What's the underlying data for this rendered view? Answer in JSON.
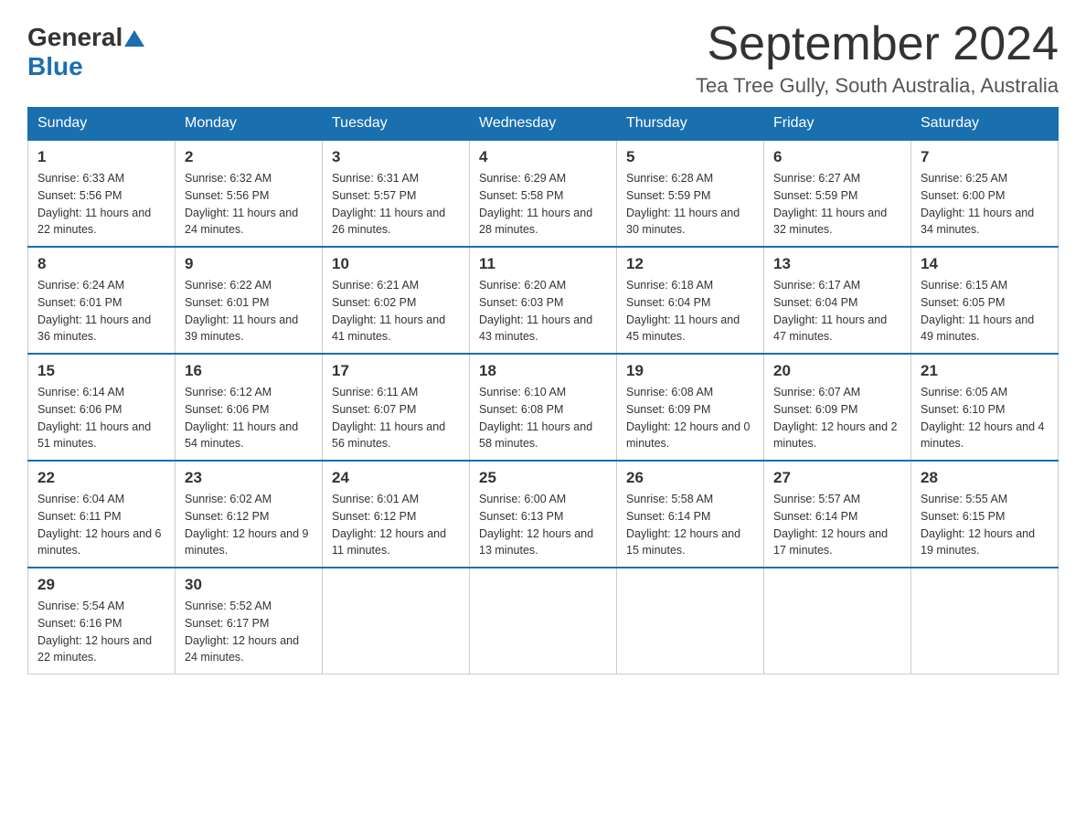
{
  "header": {
    "logo": {
      "general_text": "General",
      "blue_text": "Blue"
    },
    "title": "September 2024",
    "subtitle": "Tea Tree Gully, South Australia, Australia"
  },
  "days_of_week": [
    "Sunday",
    "Monday",
    "Tuesday",
    "Wednesday",
    "Thursday",
    "Friday",
    "Saturday"
  ],
  "weeks": [
    [
      {
        "day": "1",
        "sunrise": "Sunrise: 6:33 AM",
        "sunset": "Sunset: 5:56 PM",
        "daylight": "Daylight: 11 hours and 22 minutes."
      },
      {
        "day": "2",
        "sunrise": "Sunrise: 6:32 AM",
        "sunset": "Sunset: 5:56 PM",
        "daylight": "Daylight: 11 hours and 24 minutes."
      },
      {
        "day": "3",
        "sunrise": "Sunrise: 6:31 AM",
        "sunset": "Sunset: 5:57 PM",
        "daylight": "Daylight: 11 hours and 26 minutes."
      },
      {
        "day": "4",
        "sunrise": "Sunrise: 6:29 AM",
        "sunset": "Sunset: 5:58 PM",
        "daylight": "Daylight: 11 hours and 28 minutes."
      },
      {
        "day": "5",
        "sunrise": "Sunrise: 6:28 AM",
        "sunset": "Sunset: 5:59 PM",
        "daylight": "Daylight: 11 hours and 30 minutes."
      },
      {
        "day": "6",
        "sunrise": "Sunrise: 6:27 AM",
        "sunset": "Sunset: 5:59 PM",
        "daylight": "Daylight: 11 hours and 32 minutes."
      },
      {
        "day": "7",
        "sunrise": "Sunrise: 6:25 AM",
        "sunset": "Sunset: 6:00 PM",
        "daylight": "Daylight: 11 hours and 34 minutes."
      }
    ],
    [
      {
        "day": "8",
        "sunrise": "Sunrise: 6:24 AM",
        "sunset": "Sunset: 6:01 PM",
        "daylight": "Daylight: 11 hours and 36 minutes."
      },
      {
        "day": "9",
        "sunrise": "Sunrise: 6:22 AM",
        "sunset": "Sunset: 6:01 PM",
        "daylight": "Daylight: 11 hours and 39 minutes."
      },
      {
        "day": "10",
        "sunrise": "Sunrise: 6:21 AM",
        "sunset": "Sunset: 6:02 PM",
        "daylight": "Daylight: 11 hours and 41 minutes."
      },
      {
        "day": "11",
        "sunrise": "Sunrise: 6:20 AM",
        "sunset": "Sunset: 6:03 PM",
        "daylight": "Daylight: 11 hours and 43 minutes."
      },
      {
        "day": "12",
        "sunrise": "Sunrise: 6:18 AM",
        "sunset": "Sunset: 6:04 PM",
        "daylight": "Daylight: 11 hours and 45 minutes."
      },
      {
        "day": "13",
        "sunrise": "Sunrise: 6:17 AM",
        "sunset": "Sunset: 6:04 PM",
        "daylight": "Daylight: 11 hours and 47 minutes."
      },
      {
        "day": "14",
        "sunrise": "Sunrise: 6:15 AM",
        "sunset": "Sunset: 6:05 PM",
        "daylight": "Daylight: 11 hours and 49 minutes."
      }
    ],
    [
      {
        "day": "15",
        "sunrise": "Sunrise: 6:14 AM",
        "sunset": "Sunset: 6:06 PM",
        "daylight": "Daylight: 11 hours and 51 minutes."
      },
      {
        "day": "16",
        "sunrise": "Sunrise: 6:12 AM",
        "sunset": "Sunset: 6:06 PM",
        "daylight": "Daylight: 11 hours and 54 minutes."
      },
      {
        "day": "17",
        "sunrise": "Sunrise: 6:11 AM",
        "sunset": "Sunset: 6:07 PM",
        "daylight": "Daylight: 11 hours and 56 minutes."
      },
      {
        "day": "18",
        "sunrise": "Sunrise: 6:10 AM",
        "sunset": "Sunset: 6:08 PM",
        "daylight": "Daylight: 11 hours and 58 minutes."
      },
      {
        "day": "19",
        "sunrise": "Sunrise: 6:08 AM",
        "sunset": "Sunset: 6:09 PM",
        "daylight": "Daylight: 12 hours and 0 minutes."
      },
      {
        "day": "20",
        "sunrise": "Sunrise: 6:07 AM",
        "sunset": "Sunset: 6:09 PM",
        "daylight": "Daylight: 12 hours and 2 minutes."
      },
      {
        "day": "21",
        "sunrise": "Sunrise: 6:05 AM",
        "sunset": "Sunset: 6:10 PM",
        "daylight": "Daylight: 12 hours and 4 minutes."
      }
    ],
    [
      {
        "day": "22",
        "sunrise": "Sunrise: 6:04 AM",
        "sunset": "Sunset: 6:11 PM",
        "daylight": "Daylight: 12 hours and 6 minutes."
      },
      {
        "day": "23",
        "sunrise": "Sunrise: 6:02 AM",
        "sunset": "Sunset: 6:12 PM",
        "daylight": "Daylight: 12 hours and 9 minutes."
      },
      {
        "day": "24",
        "sunrise": "Sunrise: 6:01 AM",
        "sunset": "Sunset: 6:12 PM",
        "daylight": "Daylight: 12 hours and 11 minutes."
      },
      {
        "day": "25",
        "sunrise": "Sunrise: 6:00 AM",
        "sunset": "Sunset: 6:13 PM",
        "daylight": "Daylight: 12 hours and 13 minutes."
      },
      {
        "day": "26",
        "sunrise": "Sunrise: 5:58 AM",
        "sunset": "Sunset: 6:14 PM",
        "daylight": "Daylight: 12 hours and 15 minutes."
      },
      {
        "day": "27",
        "sunrise": "Sunrise: 5:57 AM",
        "sunset": "Sunset: 6:14 PM",
        "daylight": "Daylight: 12 hours and 17 minutes."
      },
      {
        "day": "28",
        "sunrise": "Sunrise: 5:55 AM",
        "sunset": "Sunset: 6:15 PM",
        "daylight": "Daylight: 12 hours and 19 minutes."
      }
    ],
    [
      {
        "day": "29",
        "sunrise": "Sunrise: 5:54 AM",
        "sunset": "Sunset: 6:16 PM",
        "daylight": "Daylight: 12 hours and 22 minutes."
      },
      {
        "day": "30",
        "sunrise": "Sunrise: 5:52 AM",
        "sunset": "Sunset: 6:17 PM",
        "daylight": "Daylight: 12 hours and 24 minutes."
      },
      null,
      null,
      null,
      null,
      null
    ]
  ]
}
